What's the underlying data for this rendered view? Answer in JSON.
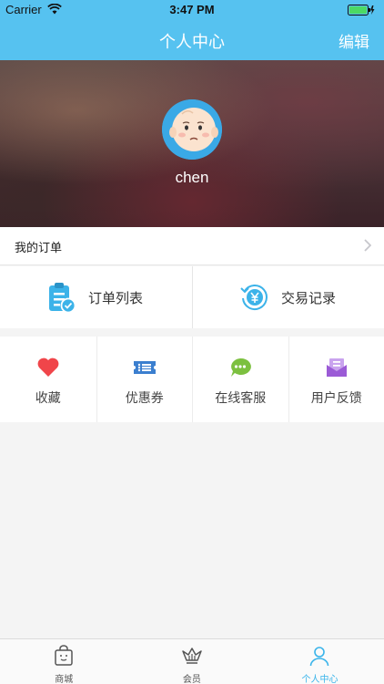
{
  "status_bar": {
    "carrier": "Carrier",
    "time": "3:47 PM"
  },
  "nav": {
    "title": "个人中心",
    "edit_label": "编辑"
  },
  "profile": {
    "username": "chen"
  },
  "orders": {
    "label": "我的订单"
  },
  "order_actions": [
    {
      "label": "订单列表",
      "icon": "clipboard-check-icon"
    },
    {
      "label": "交易记录",
      "icon": "yuan-history-icon"
    }
  ],
  "services": [
    {
      "label": "收藏",
      "icon": "heart-icon",
      "color": "#f0454a"
    },
    {
      "label": "优惠券",
      "icon": "ticket-icon",
      "color": "#3b7fcf"
    },
    {
      "label": "在线客服",
      "icon": "chat-bubble-icon",
      "color": "#7cc03f"
    },
    {
      "label": "用户反馈",
      "icon": "envelope-icon",
      "color": "#9b5bd6"
    }
  ],
  "tabs": [
    {
      "label": "商城",
      "icon": "shopping-bag-icon"
    },
    {
      "label": "会员",
      "icon": "crown-icon"
    },
    {
      "label": "个人中心",
      "icon": "person-icon"
    }
  ],
  "colors": {
    "accent": "#56c2f0",
    "active_tab": "#3ab4ea"
  }
}
